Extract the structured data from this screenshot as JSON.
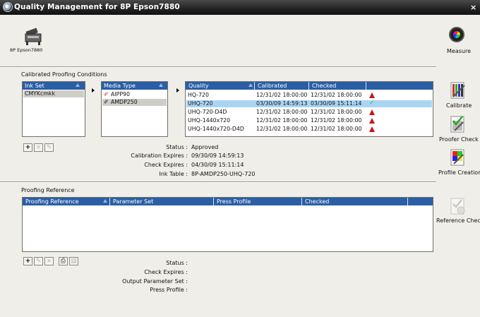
{
  "window": {
    "title": "Quality Management for 8P Epson7880",
    "close_glyph": "×"
  },
  "printer": {
    "label": "8P Epson7880",
    "icon": "printer-icon"
  },
  "measure": {
    "label": "Measure",
    "icon": "color-wheel-icon"
  },
  "calibrated": {
    "section_title": "Calibrated Proofing Conditions",
    "ink_set": {
      "header": "Ink Set",
      "items": [
        "CMYKcmkk"
      ],
      "selected": 0
    },
    "media_type": {
      "header": "Media Type",
      "items": [
        "AIPP90",
        "AMDP250"
      ],
      "selected": 1
    },
    "quality": {
      "headers": [
        "Quality",
        "Calibrated",
        "Checked"
      ],
      "rows": [
        {
          "quality": "HQ-720",
          "calibrated": "12/31/02 18:00:00",
          "checked": "12/31/02 18:00:00",
          "state": "warning"
        },
        {
          "quality": "UHQ-720",
          "calibrated": "03/30/09 14:59:13",
          "checked": "03/30/09 15:11:14",
          "state": "ok"
        },
        {
          "quality": "UHQ-720-D4D",
          "calibrated": "12/31/02 18:00:00",
          "checked": "12/31/02 18:00:00",
          "state": "warning"
        },
        {
          "quality": "UHQ-1440x720",
          "calibrated": "12/31/02 18:00:00",
          "checked": "12/31/02 18:00:00",
          "state": "warning"
        },
        {
          "quality": "UHQ-1440x720-D4D",
          "calibrated": "12/31/02 18:00:00",
          "checked": "12/31/02 18:00:00",
          "state": "warning"
        }
      ],
      "selected": 1
    },
    "toolbar": {
      "add": "+",
      "remove": "×",
      "edit": "✎"
    },
    "status": {
      "status_label": "Status :",
      "status_value": "Approved",
      "calib_label": "Calibration Expires :",
      "calib_value": "09/30/09 14:59:13",
      "check_label": "Check Expires :",
      "check_value": "04/30/09 15:11:14",
      "ink_label": "Ink Table :",
      "ink_value": "8P-AMDP250-UHQ-720"
    }
  },
  "actions": {
    "calibrate": "Calibrate",
    "proofer_check": "Proofer Check",
    "profile_creation": "Profile Creation",
    "reference_check": "Reference Check"
  },
  "proofing": {
    "section_title": "Proofing Reference",
    "headers": [
      "Proofing Reference",
      "Parameter Set",
      "Press Profile",
      "Checked"
    ],
    "toolbar": {
      "add": "+",
      "edit": "✎",
      "remove": "×",
      "import": "⎙",
      "export": "▤"
    },
    "status": {
      "status_label": "Status :",
      "check_label": "Check Expires :",
      "param_label": "Output Parameter Set :",
      "press_label": "Press Profile :"
    }
  },
  "colors": {
    "header_blue": "#2a5ea5",
    "selection_blue": "#a9d5f5",
    "warning_red": "#c8141c",
    "ok_green": "#3ab83a"
  }
}
